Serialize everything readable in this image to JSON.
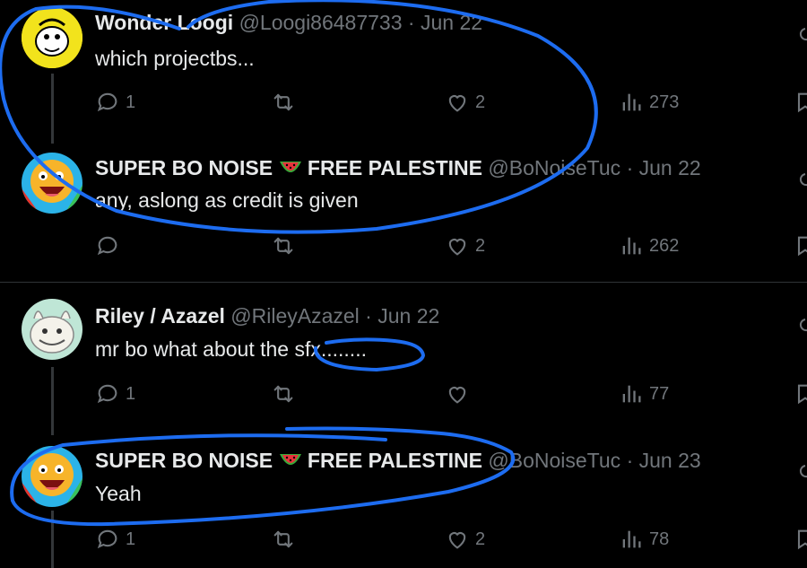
{
  "posts": [
    {
      "name": "Wonder Loogi",
      "handle": "@Loogi86487733",
      "date": "· Jun 22",
      "text": "which projectbs...",
      "replies": "1",
      "reposts": "",
      "likes": "2",
      "views": "273"
    },
    {
      "name": "SUPER BO NOISE",
      "name_suffix": "FREE PALESTINE",
      "handle": "@BoNoiseTuc",
      "date": "· Jun 22",
      "text": "any, aslong as credit is given",
      "replies": "",
      "reposts": "",
      "likes": "2",
      "views": "262"
    },
    {
      "name": "Riley / Azazel",
      "handle": "@RileyAzazel",
      "date": "· Jun 22",
      "text": "mr bo what about the sfx........",
      "replies": "1",
      "reposts": "",
      "likes": "",
      "views": "77"
    },
    {
      "name": "SUPER BO NOISE",
      "name_suffix": "FREE PALESTINE",
      "handle": "@BoNoiseTuc",
      "date": "· Jun 23",
      "text": "Yeah",
      "replies": "1",
      "reposts": "",
      "likes": "2",
      "views": "78"
    }
  ],
  "icons": {
    "reply": "reply-icon",
    "repost": "repost-icon",
    "like": "heart-icon",
    "views": "views-icon",
    "bookmark": "bookmark-icon",
    "more": "more-icon",
    "flag": "watermelon-emoji"
  },
  "colors": {
    "background": "#000000",
    "text": "#e7e9ea",
    "secondary": "#71767b",
    "annotation": "#1d6cf0"
  }
}
